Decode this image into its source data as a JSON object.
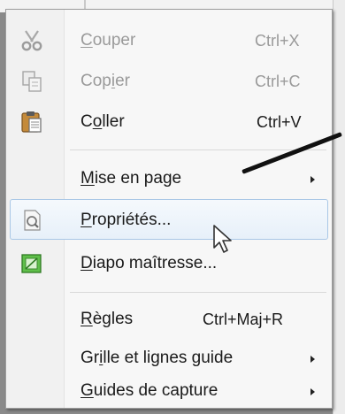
{
  "menu": {
    "items": [
      {
        "label": "Couper",
        "mnemonic": "C",
        "rest": "ouper",
        "shortcut": "Ctrl+X",
        "icon": "scissors-icon",
        "disabled": true
      },
      {
        "label": "Copier",
        "mnemonic": "i",
        "before": "Cop",
        "after": "er",
        "shortcut": "Ctrl+C",
        "icon": "copy-icon",
        "disabled": true
      },
      {
        "label": "Coller",
        "mnemonic": "o",
        "before": "C",
        "after": "ller",
        "shortcut": "Ctrl+V",
        "icon": "paste-icon",
        "disabled": false
      },
      {
        "label": "Mise en page",
        "mnemonic": "M",
        "rest": "ise en page",
        "submenu": true,
        "icon": ""
      },
      {
        "label": "Propriétés...",
        "mnemonic": "P",
        "rest": "ropriétés...",
        "icon": "properties-icon",
        "highlighted": true
      },
      {
        "label": "Diapo maîtresse...",
        "mnemonic": "D",
        "rest": "iapo maîtresse...",
        "icon": "master-slide-icon"
      },
      {
        "label": "Règles",
        "mnemonic": "R",
        "rest": "ègles",
        "shortcut": "Ctrl+Maj+R",
        "icon": ""
      },
      {
        "label": "Grille et lignes guide",
        "mnemonic": "i",
        "before": "Gr",
        "after": "lle et lignes guide",
        "submenu": true,
        "icon": ""
      },
      {
        "label": "Guides de capture",
        "mnemonic": "G",
        "rest": "uides de capture",
        "submenu": true,
        "icon": ""
      }
    ]
  },
  "colors": {
    "highlight_border": "#a9c7e6",
    "highlight_fill": "#e7f0f9",
    "disabled_text": "#9a9a9a"
  }
}
